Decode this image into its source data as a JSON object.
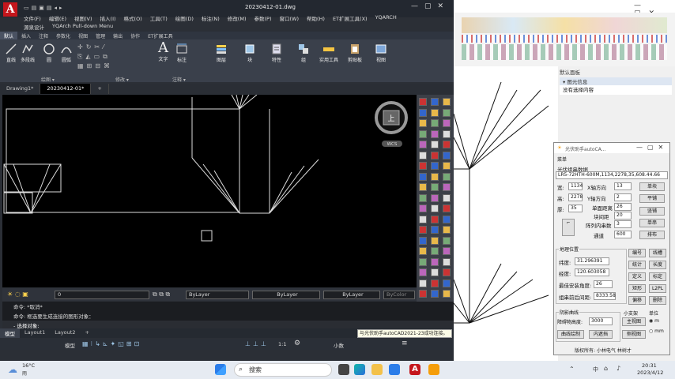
{
  "cad": {
    "title": "20230412-01.dwg",
    "menus1": [
      "文件(F)",
      "编辑(E)",
      "视图(V)",
      "插入(I)",
      "格式(O)",
      "工具(T)",
      "绘图(D)",
      "标注(N)",
      "修改(M)",
      "参数(P)",
      "窗口(W)",
      "帮助(H)",
      "ET扩展工具(X)",
      "YQARCH"
    ],
    "menus2": [
      "源泉设计",
      "YQArch Pull-down Menu"
    ],
    "ribbon_tabs": [
      "默认",
      "插入",
      "注释",
      "参数化",
      "视图",
      "管理",
      "输出",
      "协作",
      "ET扩展工具"
    ],
    "tools": {
      "line": "直线",
      "polyline": "多段线",
      "circle": "圆",
      "arc": "圆弧",
      "text": "文字",
      "dim": "标注",
      "layer": "图层",
      "block": "块",
      "props": "特性",
      "group": "组",
      "util": "实用工具",
      "clip": "剪贴板",
      "view": "视图"
    },
    "panels": {
      "draw": "绘图 ▾",
      "modify": "修改 ▾",
      "annot": "注释 ▾"
    },
    "doc_tabs": [
      "Drawing1*",
      "20230412-01*"
    ],
    "viewcube": {
      "face": "上",
      "wcs": "WCS"
    },
    "layer": {
      "name": "0",
      "color": "ByLayer",
      "linetype": "ByLayer",
      "lineweight": "ByLayer",
      "plot": "ByColor"
    },
    "command_lines": [
      "命令: *取消*",
      "命令: 框选要生成连接的图形对象："
    ],
    "command_prompt": "- 选择对象:",
    "layout_tabs": [
      "模型",
      "Layout1",
      "Layout2"
    ],
    "status": {
      "model": "模型",
      "scale": "1:1",
      "units": "小数"
    },
    "popup": "与光伏助手autoCAD2021-23成功连接。"
  },
  "right_app": {
    "panel_title": "默认面板",
    "section": "图元信息",
    "empty_msg": "没有选择内容"
  },
  "plugin": {
    "title": "光伏助手autoCA...",
    "menu": "菜单",
    "module_group": "光伏组串数据",
    "module_value": "LR5-72HTH-600M,1134,2278,35,608.44.66",
    "width_label": "宽:",
    "width": "1134",
    "height_label": "高:",
    "height": "2278",
    "thick_label": "厚:",
    "thick": "35",
    "xcount_label": "X轴方向",
    "xcount": "13",
    "ycount_label": "Y轴方向",
    "ycount": "2",
    "hspace_label": "单面距离",
    "hspace": "26",
    "block_label": "块间距",
    "block": "20",
    "array_label": "阵列内串数",
    "array": "3",
    "channel_label": "通道",
    "channel": "600",
    "btn_single": "单块",
    "btn_flat": "平铺",
    "btn_vert": "竖铺",
    "btn_string": "单串",
    "btn_arrange": "排布",
    "geo_group": "地理位置",
    "lat_label": "纬度:",
    "lat": "31.296391",
    "lon_label": "经度:",
    "lon": "120.603058",
    "tilt_label": "最佳安装角度:",
    "tilt": "26",
    "spacing_label": "组串前后间距:",
    "spacing": "8333.58",
    "btn_number": "编号",
    "btn_wire": "线槽",
    "btn_stat": "统计",
    "btn_length": "长度",
    "btn_define": "定义",
    "btn_mark": "标定",
    "btn_rect": "矩形",
    "btn_l2pl": "L2PL",
    "btn_move": "偏移",
    "btn_delete": "删除",
    "shade_group": "阴影曲线",
    "obstacle_label": "障碍物高度:",
    "obstacle": "3000",
    "btn_main": "主视图",
    "btn_curve": "曲线绘制",
    "btn_inner": "内遮挡",
    "btn_side": "侧视图",
    "small_roof": "小支架",
    "unit_group": "单位",
    "unit_m": "m",
    "unit_mm": "mm",
    "footer": "版权所有: 小林电气 林树才"
  },
  "taskbar": {
    "weather_temp": "16°C",
    "weather_desc": "雨",
    "search": "搜索",
    "lang": "中",
    "time": "20:31",
    "date": "2023/4/12"
  }
}
